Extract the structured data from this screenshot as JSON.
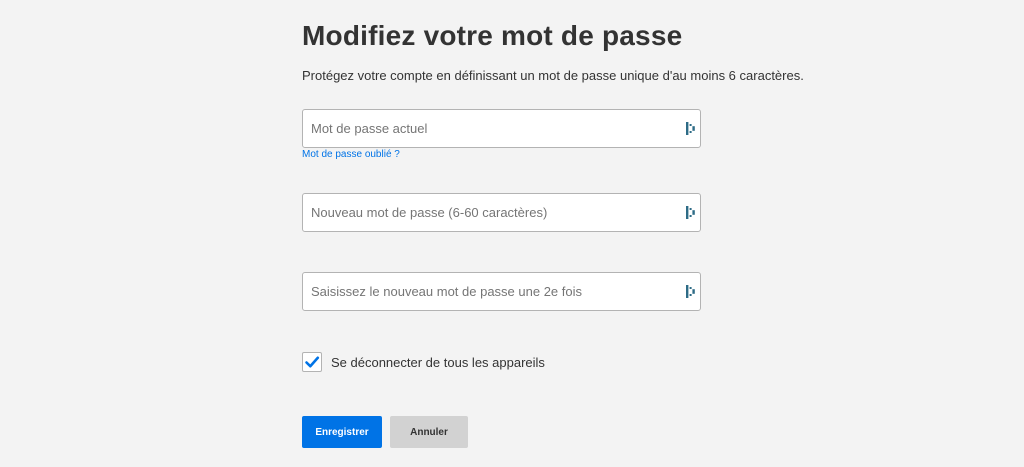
{
  "header": {
    "title": "Modifiez votre mot de passe",
    "subtitle": "Protégez votre compte en définissant un mot de passe unique d'au moins 6 caractères."
  },
  "fields": {
    "current_password": {
      "value": "",
      "placeholder": "Mot de passe actuel",
      "icon": "password-manager-icon"
    },
    "forgot_link": "Mot de passe oublié ?",
    "new_password": {
      "value": "",
      "placeholder": "Nouveau mot de passe (6-60 caractères)",
      "icon": "password-manager-icon"
    },
    "confirm_password": {
      "value": "",
      "placeholder": "Saisissez le nouveau mot de passe une 2e fois",
      "icon": "password-manager-icon"
    }
  },
  "signout": {
    "label": "Se déconnecter de tous les appareils",
    "checked": true
  },
  "actions": {
    "save_label": "Enregistrer",
    "cancel_label": "Annuler"
  },
  "colors": {
    "accent": "#0073e6",
    "background": "#f3f3f3",
    "cancel_bg": "#d2d2d2",
    "icon": "#2d6b86"
  }
}
